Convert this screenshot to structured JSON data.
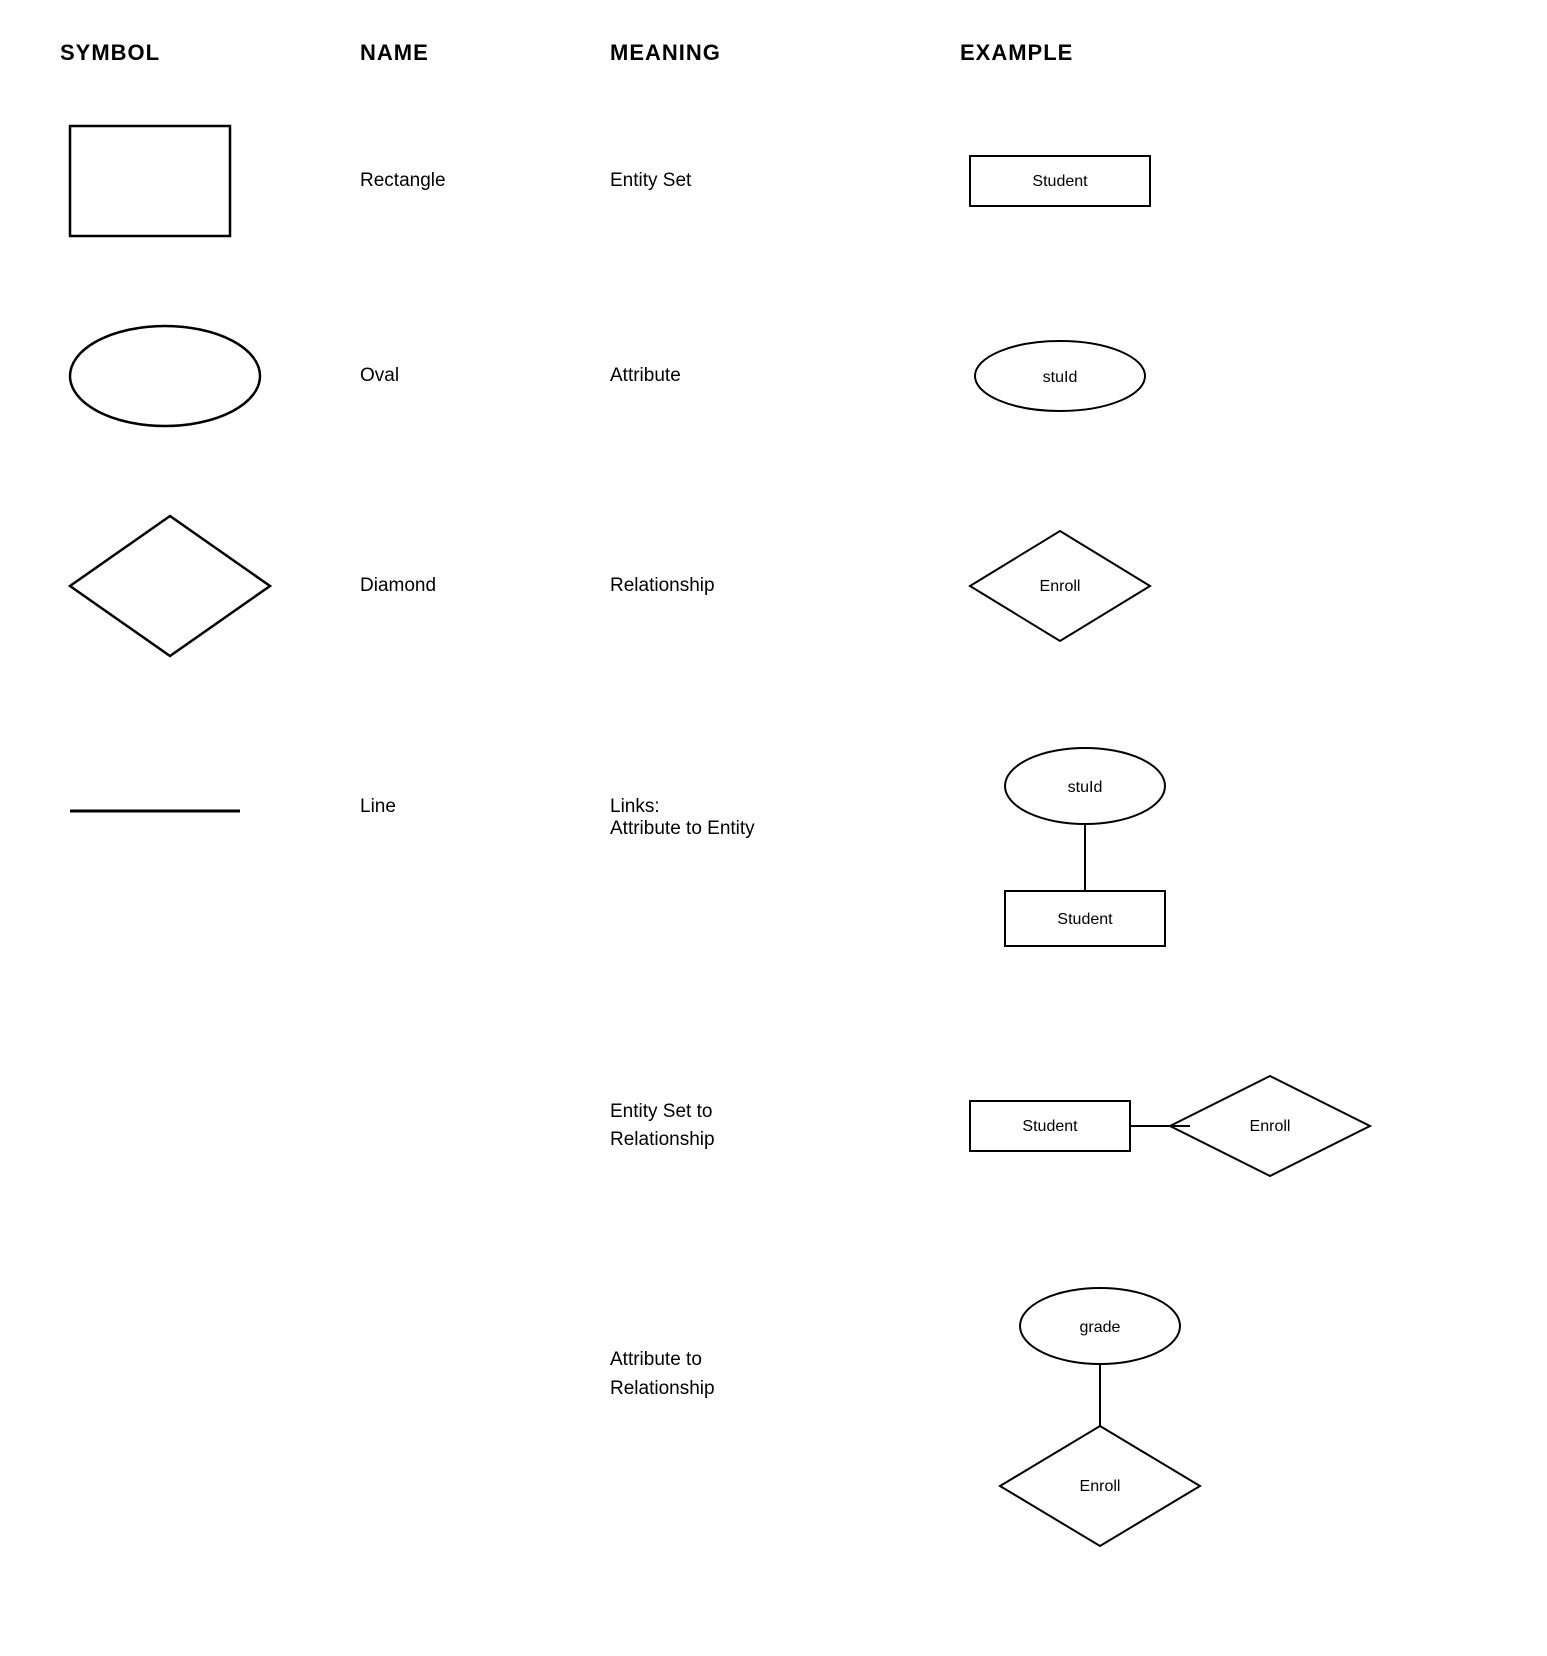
{
  "header": {
    "col1": "SYMBOL",
    "col2": "NAME",
    "col3": "MEANING",
    "col4": "EXAMPLE"
  },
  "rows": [
    {
      "id": "rectangle",
      "name": "Rectangle",
      "meaning": "Entity Set",
      "example_label": "Student"
    },
    {
      "id": "oval",
      "name": "Oval",
      "meaning": "Attribute",
      "example_label": "stuId"
    },
    {
      "id": "diamond",
      "name": "Diamond",
      "meaning": "Relationship",
      "example_label": "Enroll"
    },
    {
      "id": "line",
      "name": "Line",
      "meaning_line1": "Links:",
      "meaning_line2": "Attribute to Entity",
      "example_oval": "stuId",
      "example_rect": "Student"
    },
    {
      "id": "entity-to-rel",
      "meaning": "Entity Set to\nRelationship",
      "example_rect": "Student",
      "example_diamond": "Enroll"
    },
    {
      "id": "attr-to-rel",
      "meaning": "Attribute to\nRelationship",
      "example_oval": "grade",
      "example_diamond": "Enroll"
    }
  ]
}
